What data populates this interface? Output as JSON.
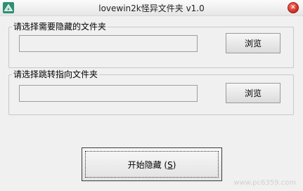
{
  "window": {
    "title": "lovewin2k怪异文件夹 v1.0",
    "close_glyph": "✕"
  },
  "hide_group": {
    "label": "请选择需要隐藏的文件夹",
    "input_value": "",
    "browse_label": "浏览"
  },
  "redirect_group": {
    "label": "请选择跳转指向文件夹",
    "input_value": "",
    "browse_label": "浏览"
  },
  "start_button": {
    "label": "开始隐藏",
    "shortcut_open": "(",
    "shortcut_key": "S",
    "shortcut_close": ")"
  },
  "watermark": {
    "text": "www.pc6359.com"
  },
  "colors": {
    "window_bg": "#f0f0f0",
    "close_red": "#d8392b",
    "icon_green": "#2f8f73"
  },
  "icons": {
    "app": "app-logo-icon",
    "close": "close-icon"
  }
}
